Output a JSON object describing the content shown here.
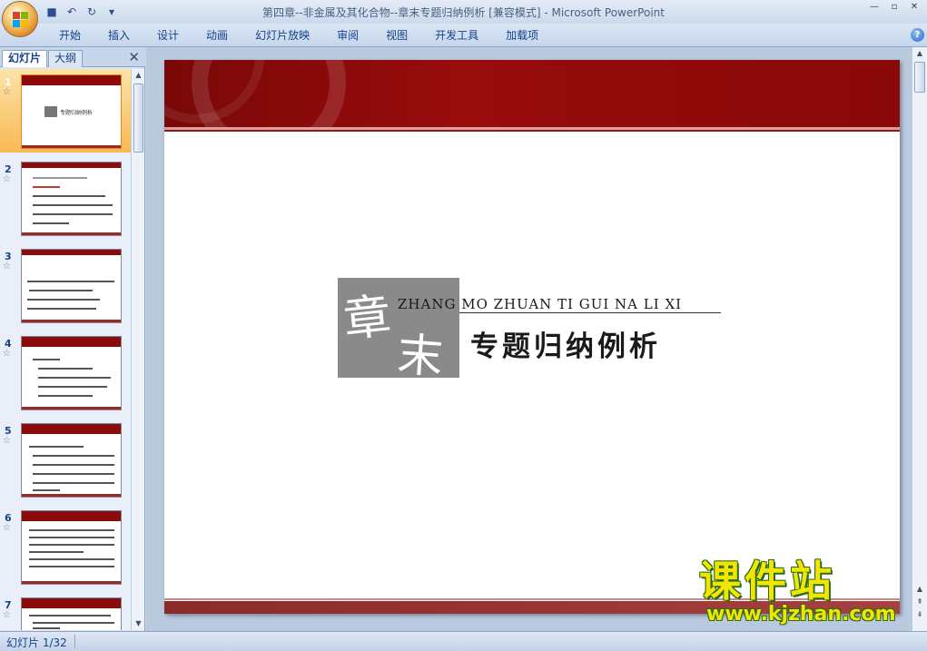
{
  "window": {
    "title": "第四章--非金属及其化合物--章末专题归纳例析 [兼容模式] - Microsoft PowerPoint",
    "controls": [
      "—",
      "▫",
      "✕"
    ]
  },
  "quick_access": {
    "icons": [
      "save-icon",
      "undo-icon",
      "redo-icon",
      "customize-icon"
    ],
    "glyphs": [
      "■",
      "↶",
      "↻",
      "▾"
    ]
  },
  "ribbon": {
    "tabs": [
      "开始",
      "插入",
      "设计",
      "动画",
      "幻灯片放映",
      "审阅",
      "视图",
      "开发工具",
      "加载项"
    ],
    "help": "?"
  },
  "left_pane": {
    "tabs": [
      "幻灯片",
      "大纲"
    ],
    "close": "✕",
    "slides": [
      {
        "number": "1",
        "star": "☆",
        "label": "专题归纳例析"
      },
      {
        "number": "2",
        "star": "☆"
      },
      {
        "number": "3",
        "star": "☆"
      },
      {
        "number": "4",
        "star": "☆"
      },
      {
        "number": "5",
        "star": "☆"
      },
      {
        "number": "6",
        "star": "☆"
      },
      {
        "number": "7",
        "star": "☆"
      }
    ]
  },
  "slide": {
    "seal_chars": [
      "章",
      "末"
    ],
    "pinyin": "ZHANG MO ZHUAN TI GUI NA LI XI",
    "title": "专题归纳例析"
  },
  "watermark": {
    "chinese": "课件站",
    "url": "www.kjzhan.com"
  },
  "status": {
    "slide_indicator": "幻灯片 1/32"
  },
  "colors": {
    "slide_band": "#8b0a0a",
    "selection": "#f8b955",
    "watermark_yellow": "#f2e600"
  }
}
